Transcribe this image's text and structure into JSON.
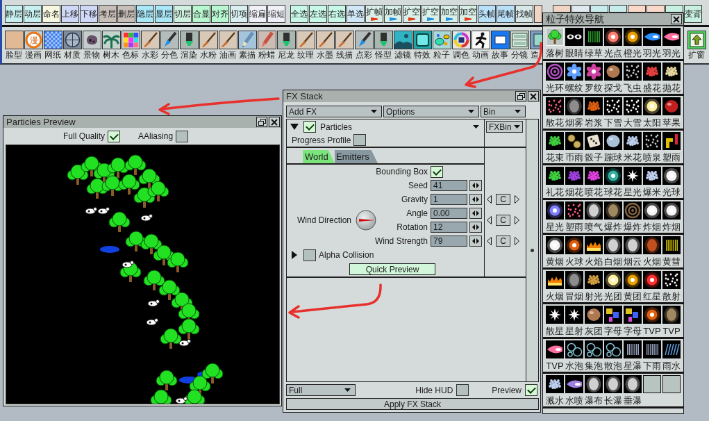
{
  "toolbar": {
    "groups": [
      {
        "buttons": [
          {
            "label": "静层",
            "color": "#c8f0f0"
          },
          {
            "label": "动层",
            "color": "#c8f0f0"
          },
          {
            "label": "命名",
            "color": "#f8f8e0"
          },
          {
            "label": "上移",
            "color": "#d0d8f8"
          },
          {
            "label": "下移",
            "color": "#d0d8f8"
          },
          {
            "label": "考层",
            "color": "#c8c0b8"
          },
          {
            "label": "删层",
            "color": "#c8c0b8"
          },
          {
            "label": "隐层",
            "color": "#a8e8f8"
          },
          {
            "label": "显层",
            "color": "#a8e8f8"
          },
          {
            "label": "切层",
            "color": "#d0f0e0"
          },
          {
            "label": "合显",
            "color": "#b8f8d0"
          },
          {
            "label": "对齐",
            "color": "#b8f8d0"
          },
          {
            "label": "切项",
            "color": "#d8f0f0"
          },
          {
            "label": "缩扁",
            "color": "#f0f0f8"
          },
          {
            "label": "缩短",
            "color": "#f0f0f8"
          }
        ]
      },
      {
        "buttons": [
          {
            "label": "全选",
            "color": "#c8f8e8"
          },
          {
            "label": "左选",
            "color": "#c8f8e8"
          },
          {
            "label": "右选",
            "color": "#c8f8e8"
          },
          {
            "label": "单选",
            "color": "#d0e8f8"
          },
          {
            "label": "扩帧",
            "color": "#d8f0e8",
            "marker": {
              "color": "#e83818"
            }
          },
          {
            "label": "加帧",
            "color": "#d8f0e8",
            "marker": {
              "color": "#2090e0"
            }
          },
          {
            "label": "扩空",
            "color": "#d8f0e8",
            "marker": {
              "color": "#e83818"
            }
          },
          {
            "label": "扩空",
            "color": "#d8f0e8",
            "marker": {
              "color": "#2090e0"
            }
          },
          {
            "label": "加空",
            "color": "#d8f0e8",
            "marker": {
              "color": "#2090e0"
            }
          },
          {
            "label": "加空",
            "color": "#d8f0e8",
            "marker": {
              "color": "#e83818"
            }
          },
          {
            "label": "头帧",
            "color": "#b8e0f8"
          },
          {
            "label": "尾帧",
            "color": "#b8e0f8"
          },
          {
            "label": "找帧",
            "color": "#d8e8e8"
          },
          {
            "color": "#f0d4c4"
          },
          {
            "color": "#f0d4c4"
          },
          {
            "color": "#e0e8f0"
          },
          {
            "color": "#c8ecec"
          },
          {
            "color": "#c8ecec"
          },
          {
            "color": "#f8d8c8"
          },
          {
            "color": "#f8d8c8"
          },
          {
            "color": "#c8f0e0"
          },
          {
            "label": "变背",
            "color": "#c8f0e0"
          }
        ]
      }
    ]
  },
  "tools": {
    "items": [
      {
        "label": "脸型",
        "kind": "photo"
      },
      {
        "label": "漫画",
        "kind": "badge",
        "glyph": "漫"
      },
      {
        "label": "网纸",
        "kind": "checker"
      },
      {
        "label": "材质",
        "kind": "texture"
      },
      {
        "label": "景物",
        "kind": "rock"
      },
      {
        "label": "树木",
        "kind": "palm"
      },
      {
        "label": "色标",
        "kind": "swatches"
      },
      {
        "label": "水彩",
        "kind": "brush"
      },
      {
        "label": "分色",
        "kind": "pen"
      },
      {
        "label": "渲染",
        "kind": "marker"
      },
      {
        "label": "水粉",
        "kind": "brush"
      },
      {
        "label": "油画",
        "kind": "brush"
      },
      {
        "label": "素描",
        "kind": "pencil"
      },
      {
        "label": "粉蜡",
        "kind": "crayon"
      },
      {
        "label": "尼龙",
        "kind": "marker"
      },
      {
        "label": "纹理",
        "kind": "brush"
      },
      {
        "label": "水墨",
        "kind": "brush"
      },
      {
        "label": "线描",
        "kind": "brush"
      },
      {
        "label": "点彩",
        "kind": "pen"
      },
      {
        "label": "怪型",
        "kind": "marker"
      },
      {
        "label": "滤镜",
        "kind": "scene"
      },
      {
        "label": "特效",
        "kind": "square"
      },
      {
        "label": "粒子",
        "kind": "blobs"
      },
      {
        "label": "调色",
        "kind": "wheel"
      },
      {
        "label": "动画",
        "kind": "runner"
      },
      {
        "label": "故事",
        "kind": "frame"
      },
      {
        "label": "分镜",
        "kind": "grid"
      },
      {
        "label": "造",
        "kind": "panel"
      }
    ],
    "end_item": {
      "label": "扩窗",
      "kind": "expand"
    }
  },
  "effects_panel": {
    "title": "粒子特效导航",
    "rows": [
      [
        {
          "label": "落树",
          "kind": "tree",
          "selected": true
        },
        {
          "label": "眼睛",
          "kind": "eyes",
          "selected": false
        },
        {
          "label": "绿草",
          "kind": "grass",
          "selected": false
        },
        {
          "label": "光点",
          "kind": "spark",
          "selected": false
        },
        {
          "label": "橙光",
          "kind": "orb",
          "selected": false
        },
        {
          "label": "羽光",
          "kind": "jet",
          "selected": false
        },
        {
          "label": "羽光",
          "kind": "plume",
          "selected": false
        }
      ],
      [
        {
          "label": "光环",
          "kind": "halo",
          "selected": false
        },
        {
          "label": "螺纹",
          "kind": "pinwheel",
          "selected": false
        },
        {
          "label": "罗纹",
          "kind": "rosette",
          "selected": false
        },
        {
          "label": "探戈",
          "kind": "pebble",
          "selected": false
        },
        {
          "label": "飞虫",
          "kind": "specks",
          "selected": false
        },
        {
          "label": "盛花",
          "kind": "blossom",
          "selected": false
        },
        {
          "label": "抛花",
          "kind": "confetti",
          "selected": false
        }
      ],
      [
        {
          "label": "散花",
          "kind": "petals",
          "selected": false
        },
        {
          "label": "烟雾",
          "kind": "haze",
          "selected": false
        },
        {
          "label": "岩浆",
          "kind": "lava",
          "selected": false
        },
        {
          "label": "下雪",
          "kind": "snow",
          "selected": false
        },
        {
          "label": "大雪",
          "kind": "snow",
          "selected": false
        },
        {
          "label": "太阳",
          "kind": "sun",
          "selected": false
        },
        {
          "label": "苹果",
          "kind": "apple",
          "selected": false
        }
      ],
      [
        {
          "label": "花束",
          "kind": "bouquet",
          "selected": false
        },
        {
          "label": "币雨",
          "kind": "coins",
          "selected": false
        },
        {
          "label": "骰子",
          "kind": "dice",
          "selected": false
        },
        {
          "label": "蹦球",
          "kind": "ball",
          "selected": false
        },
        {
          "label": "米花",
          "kind": "popcorn",
          "selected": false
        },
        {
          "label": "喷泉",
          "kind": "specks",
          "selected": false
        },
        {
          "label": "塑雨",
          "kind": "bars",
          "selected": false
        }
      ],
      [
        {
          "label": "礼花",
          "kind": "bouquet",
          "selected": false
        },
        {
          "label": "烟花",
          "kind": "burst",
          "selected": false
        },
        {
          "label": "喷花",
          "kind": "spray",
          "selected": false
        },
        {
          "label": "球花",
          "kind": "bloom",
          "selected": false
        },
        {
          "label": "星光",
          "kind": "star",
          "selected": false
        },
        {
          "label": "爆米",
          "kind": "popcorn",
          "selected": false
        },
        {
          "label": "光球",
          "kind": "flash",
          "selected": false
        }
      ],
      [
        {
          "label": "星光",
          "kind": "nova",
          "selected": false
        },
        {
          "label": "塑雨",
          "kind": "petals",
          "selected": false
        },
        {
          "label": "喷气",
          "kind": "steam",
          "selected": false
        },
        {
          "label": "爆炸",
          "kind": "dust",
          "selected": false
        },
        {
          "label": "爆炸",
          "kind": "ring",
          "selected": false
        },
        {
          "label": "炸烟",
          "kind": "flash",
          "selected": false
        },
        {
          "label": "炸烟",
          "kind": "flash",
          "selected": false
        }
      ],
      [
        {
          "label": "黄烟",
          "kind": "flash",
          "selected": false
        },
        {
          "label": "火球",
          "kind": "ember",
          "selected": false
        },
        {
          "label": "火焰",
          "kind": "flame",
          "selected": false
        },
        {
          "label": "白烟",
          "kind": "steam",
          "selected": false
        },
        {
          "label": "烟云",
          "kind": "steam",
          "selected": false
        },
        {
          "label": "火烟",
          "kind": "soot",
          "selected": false
        },
        {
          "label": "黄彗",
          "kind": "comet",
          "selected": false
        }
      ],
      [
        {
          "label": "火烟",
          "kind": "flame",
          "selected": false
        },
        {
          "label": "冒烟",
          "kind": "haze",
          "selected": false
        },
        {
          "label": "射光",
          "kind": "ray",
          "selected": false
        },
        {
          "label": "光团",
          "kind": "sun",
          "selected": false
        },
        {
          "label": "黄团",
          "kind": "orb",
          "selected": false
        },
        {
          "label": "红星",
          "kind": "redstar",
          "selected": false
        },
        {
          "label": "散射",
          "kind": "snow",
          "selected": false
        }
      ],
      [
        {
          "label": "散星",
          "kind": "star",
          "selected": false
        },
        {
          "label": "星射",
          "kind": "star",
          "selected": false
        },
        {
          "label": "灰团",
          "kind": "pebble",
          "selected": false
        },
        {
          "label": "字母",
          "kind": "letters",
          "selected": false
        },
        {
          "label": "字母",
          "kind": "letters",
          "selected": false
        },
        {
          "label": "TVP",
          "kind": "ember",
          "selected": false
        },
        {
          "label": "TVP",
          "kind": "dust",
          "selected": false
        }
      ],
      [
        {
          "label": "TVP",
          "kind": "plume",
          "selected": false
        },
        {
          "label": "水泡",
          "kind": "bubbles",
          "selected": false
        },
        {
          "label": "集泡",
          "kind": "bubbles",
          "selected": false
        },
        {
          "label": "散泡",
          "kind": "bubbles",
          "selected": false
        },
        {
          "label": "星瀑",
          "kind": "rainfall",
          "selected": false
        },
        {
          "label": "下雨",
          "kind": "rainfall",
          "selected": false
        },
        {
          "label": "雨水",
          "kind": "rain",
          "selected": false
        }
      ],
      [
        {
          "label": "溅水",
          "kind": "popcorn",
          "selected": false
        },
        {
          "label": "水喷",
          "kind": "wisp",
          "selected": false
        },
        {
          "label": "瀑布",
          "kind": "steam",
          "selected": false
        },
        {
          "label": "长瀑",
          "kind": "steam",
          "selected": false
        },
        {
          "label": "垂瀑",
          "kind": "steam",
          "selected": false
        },
        {
          "kind": "empty"
        },
        {
          "kind": "empty"
        }
      ]
    ]
  },
  "fx_stack": {
    "title": "FX Stack",
    "menus": [
      {
        "label": "Add FX"
      },
      {
        "label": "Options"
      },
      {
        "label": "Bin"
      }
    ],
    "effect": {
      "name": "Particles",
      "enabled": true,
      "expanded": true
    },
    "progress_profile": {
      "label": "Progress Profile",
      "checked": false
    },
    "bin_button": "FXBin",
    "tabs": [
      {
        "label": "World",
        "selected": true
      },
      {
        "label": "Emitters",
        "selected": false
      }
    ],
    "fields": [
      {
        "kind": "checkbox",
        "label": "Bounding Box",
        "checked": true
      },
      {
        "kind": "number",
        "label": "Seed",
        "value": "41"
      },
      {
        "kind": "number",
        "label": "Gravity",
        "value": "1",
        "keyframe_button": "C"
      },
      {
        "kind": "number",
        "label": "Angle",
        "value": "0.00"
      },
      {
        "kind": "number",
        "label": "Rotation",
        "value": "12"
      },
      {
        "kind": "number",
        "label": "Wind Strength",
        "value": "79",
        "keyframe_button": "C"
      }
    ],
    "wind_direction": {
      "label": "Wind Direction",
      "keyframe_button": "C"
    },
    "alpha_collision": {
      "label": "Alpha Collision",
      "checked": false,
      "expanded": false
    },
    "quick_preview": "Quick Preview",
    "quality": "Full",
    "hide_hud": {
      "label": "Hide HUD",
      "checked": false
    },
    "preview": {
      "label": "Preview",
      "checked": true
    },
    "apply_button": "Apply FX Stack"
  },
  "preview_window": {
    "title": "Particles Preview",
    "options": [
      {
        "label": "Full Quality",
        "checked": true
      },
      {
        "label": "AAliasing",
        "checked": false
      }
    ]
  }
}
